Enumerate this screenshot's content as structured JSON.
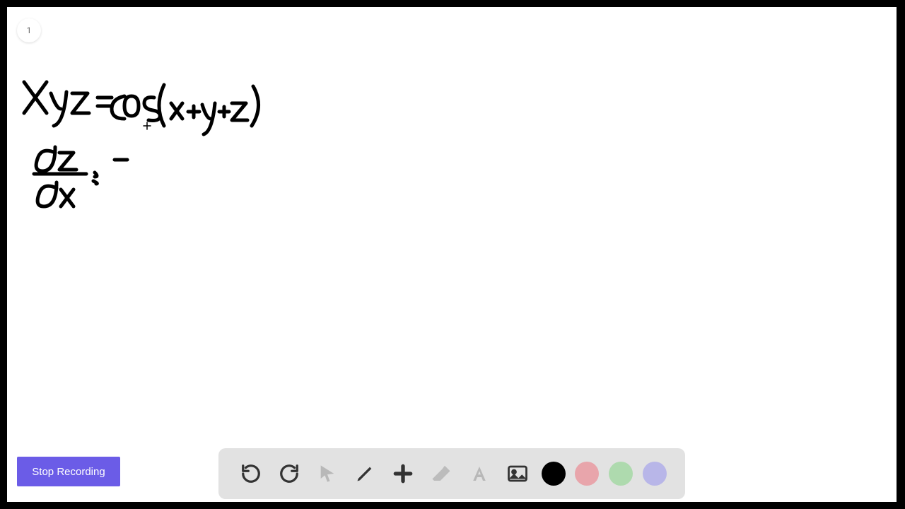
{
  "page_number": "1",
  "stop_button_label": "Stop Recording",
  "toolbar": {
    "undo": "undo-icon",
    "redo": "redo-icon",
    "pointer": "pointer-icon",
    "pencil": "pencil-icon",
    "plus": "plus-icon",
    "eraser": "eraser-icon",
    "text": "text-icon",
    "image": "image-icon"
  },
  "colors": {
    "black": "#000000",
    "pink": "#e8a5ab",
    "green": "#aedaae",
    "purple": "#b8b6e8",
    "accent": "#6b5ce7"
  },
  "handwriting": {
    "line1": "Xyz = cos (x+y+z)",
    "line2": "dz/dx = -"
  }
}
